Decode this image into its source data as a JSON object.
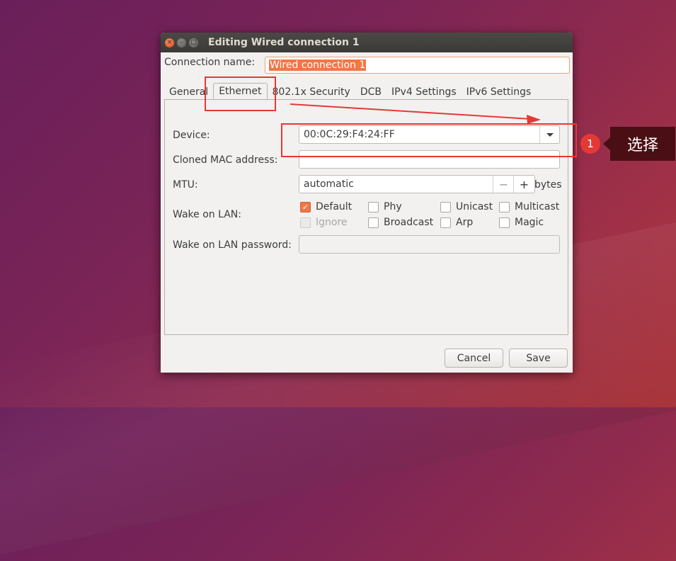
{
  "window": {
    "title": "Editing Wired connection 1",
    "close_glyph": "×",
    "min_glyph": "–",
    "max_glyph": "□"
  },
  "connection": {
    "label": "Connection name:",
    "value": "Wired connection 1"
  },
  "tabs": [
    {
      "label": "General"
    },
    {
      "label": "Ethernet"
    },
    {
      "label": "802.1x Security"
    },
    {
      "label": "DCB"
    },
    {
      "label": "IPv4 Settings"
    },
    {
      "label": "IPv6 Settings"
    }
  ],
  "ethernet": {
    "device_label": "Device:",
    "device_value": "00:0C:29:F4:24:FF",
    "cloned_mac_label": "Cloned MAC address:",
    "cloned_mac_value": "",
    "mtu_label": "MTU:",
    "mtu_value": "automatic",
    "mtu_minus": "−",
    "mtu_plus": "+",
    "mtu_unit": "bytes",
    "wol_label": "Wake on LAN:",
    "wol_options": [
      {
        "label": "Default",
        "checked": true,
        "disabled": false
      },
      {
        "label": "Phy",
        "checked": false,
        "disabled": false
      },
      {
        "label": "Unicast",
        "checked": false,
        "disabled": false
      },
      {
        "label": "Multicast",
        "checked": false,
        "disabled": false
      },
      {
        "label": "Ignore",
        "checked": false,
        "disabled": true
      },
      {
        "label": "Broadcast",
        "checked": false,
        "disabled": false
      },
      {
        "label": "Arp",
        "checked": false,
        "disabled": false
      },
      {
        "label": "Magic",
        "checked": false,
        "disabled": false
      }
    ],
    "wol_password_label": "Wake on LAN password:",
    "wol_password_value": ""
  },
  "buttons": {
    "cancel": "Cancel",
    "save": "Save"
  },
  "annotation": {
    "number": "1",
    "text": "选择",
    "color": "#e53935"
  },
  "colors": {
    "accent": "#f07746",
    "titlebar": "#3b3a36"
  }
}
